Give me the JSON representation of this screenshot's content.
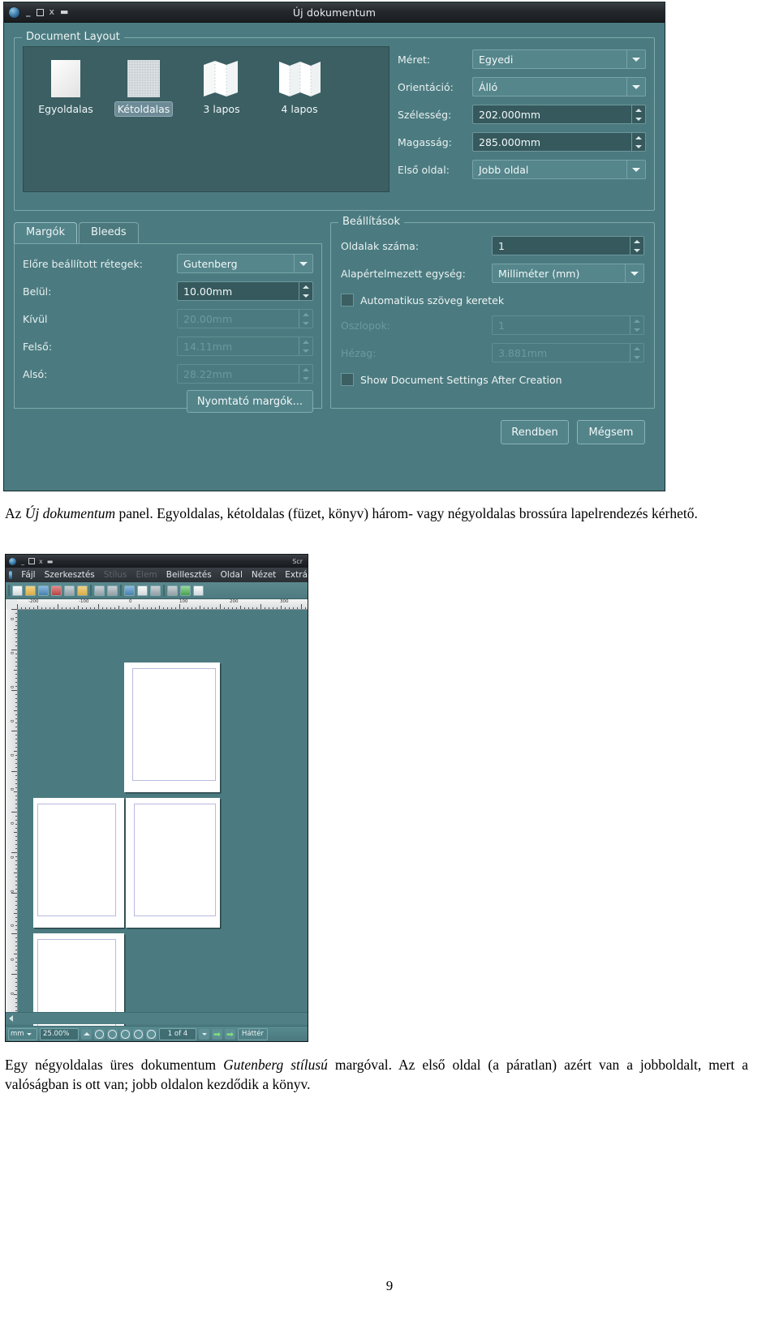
{
  "dialog": {
    "title": "Új dokumentum",
    "window_buttons": [
      "minimize",
      "maximize",
      "close",
      "shade"
    ],
    "document_layout": {
      "group_label": "Document Layout",
      "options": [
        {
          "label": "Egyoldalas",
          "icon": "single-page-icon",
          "selected": false
        },
        {
          "label": "Kétoldalas",
          "icon": "double-page-icon",
          "selected": true
        },
        {
          "label": "3 lapos",
          "icon": "three-fold-icon",
          "selected": false
        },
        {
          "label": "4 lapos",
          "icon": "four-fold-icon",
          "selected": false
        }
      ]
    },
    "page_fields": [
      {
        "label": "Méret:",
        "accel": "M",
        "value": "Egyedi",
        "type": "combo",
        "disabled": false
      },
      {
        "label": "Orientáció:",
        "accel": "O",
        "value": "Álló",
        "type": "combo",
        "disabled": false
      },
      {
        "label": "Szélesség:",
        "accel": "S",
        "value": "202.000mm",
        "type": "spin",
        "disabled": false
      },
      {
        "label": "Magasság:",
        "accel": "M",
        "value": "285.000mm",
        "type": "spin",
        "disabled": false
      },
      {
        "label": "Első oldal:",
        "accel": "",
        "value": "Jobb oldal",
        "type": "combo",
        "disabled": false
      }
    ],
    "tabs": [
      {
        "label": "Margók",
        "active": true
      },
      {
        "label": "Bleeds",
        "active": false
      }
    ],
    "margins": {
      "preset_label": "Előre beállított rétegek:",
      "preset_value": "Gutenberg",
      "fields": [
        {
          "label": "Belül:",
          "accel": "B",
          "value": "10.00mm",
          "disabled": false
        },
        {
          "label": "Kívül",
          "accel": "K",
          "value": "20.00mm",
          "disabled": true
        },
        {
          "label": "Felső:",
          "accel": "F",
          "value": "14.11mm",
          "disabled": true
        },
        {
          "label": "Alsó:",
          "accel": "A",
          "value": "28.22mm",
          "disabled": true
        }
      ],
      "printer_margins_button": "Nyomtató margók..."
    },
    "settings": {
      "group_label": "Beállítások",
      "page_count_label": "Oldalak száma:",
      "page_count_value": "1",
      "default_unit_label": "Alapértelmezett egység:",
      "default_unit_value": "Milliméter (mm)",
      "auto_text_frames_label": "Automatikus szöveg keretek",
      "auto_text_frames_checked": false,
      "columns_label": "Oszlopok:",
      "columns_value": "1",
      "gap_label": "Hézag:",
      "gap_value": "3.881mm",
      "show_settings_label": "Show Document Settings After Creation",
      "show_settings_checked": false
    },
    "footer": {
      "ok": "Rendben",
      "cancel": "Mégsem"
    }
  },
  "caption1": {
    "part1": "Az ",
    "em1": "Új dokumentum",
    "part2": " panel. Egyoldalas, kétoldalas (füzet, könyv) három- vagy négyoldalas brossúra lapelrendezés kérhető."
  },
  "scribus": {
    "title": "Scr",
    "menus": [
      {
        "label": "Fájl",
        "accel": "F",
        "disabled": false
      },
      {
        "label": "Szerkesztés",
        "accel": "S",
        "disabled": false
      },
      {
        "label": "Stílus",
        "accel": "",
        "disabled": true
      },
      {
        "label": "Elem",
        "accel": "",
        "disabled": true
      },
      {
        "label": "Beillesztés",
        "accel": "B",
        "disabled": false
      },
      {
        "label": "Oldal",
        "accel": "O",
        "disabled": false
      },
      {
        "label": "Nézet",
        "accel": "N",
        "disabled": false
      },
      {
        "label": "Extrá",
        "accel": "E",
        "disabled": false
      }
    ],
    "ruler_h_labels": [
      "-200",
      "-100",
      "0",
      "100",
      "200",
      "300"
    ],
    "ruler_v_labels": [
      "0",
      "0",
      "0",
      "0",
      "0",
      "0",
      "0",
      "0",
      "0",
      "0",
      "0",
      "0"
    ],
    "statusbar": {
      "unit": "mm",
      "zoom": "25.00%",
      "page_indicator": "1 of 4",
      "layer": "Háttér"
    }
  },
  "caption2": {
    "part1": "Egy négyoldalas üres dokumentum ",
    "em1": "Gutenberg stílusú",
    "part2": " margóval. Az első oldal (a páratlan) azért van a jobboldalt, mert a valóságban is ott van; jobb oldalon kezdődik a könyv."
  },
  "page_number": "9"
}
